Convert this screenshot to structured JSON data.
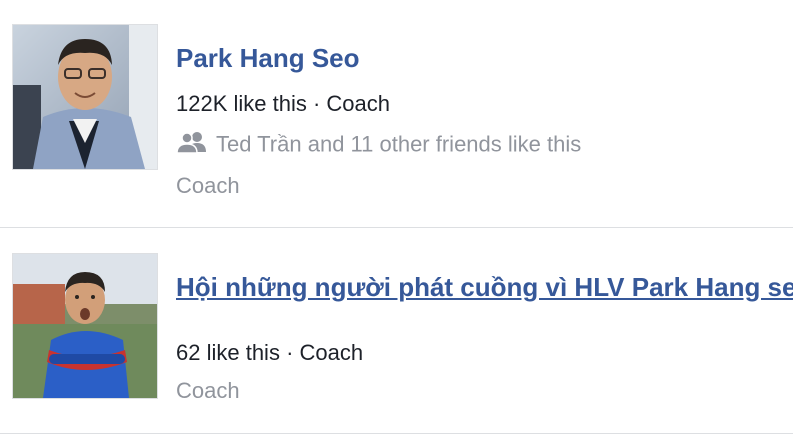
{
  "results": [
    {
      "name": "Park Hang Seo",
      "likes": "122K like this",
      "separator": " · ",
      "type": "Coach",
      "friends_text": "Ted Trần and 11 other friends like this",
      "category": "Coach",
      "icon": "friends-icon"
    },
    {
      "name": "Hội những người phát cuồng vì HLV Park Hang seo",
      "likes": "62 like this",
      "separator": " · ",
      "type": "Coach",
      "category": "Coach"
    }
  ],
  "colors": {
    "link": "#365899",
    "text": "#1d2129",
    "muted": "#90949c",
    "divider": "#dddfe2"
  }
}
